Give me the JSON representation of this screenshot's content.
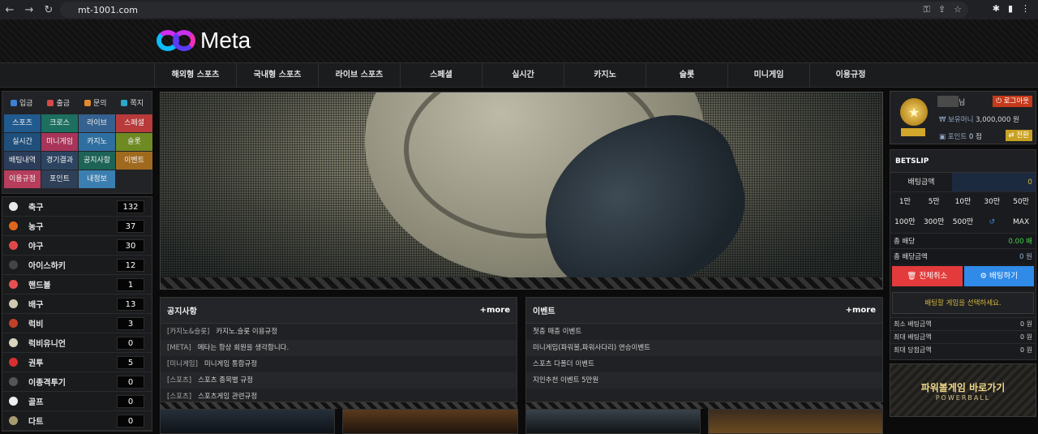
{
  "browser": {
    "url": "mt-1001.com"
  },
  "brand": {
    "name": "Meta"
  },
  "menu": [
    "해외형 스포츠",
    "국내형 스포츠",
    "라이브 스포츠",
    "스페셜",
    "실시간",
    "카지노",
    "슬롯",
    "미니게임",
    "이용규정"
  ],
  "quick_links": [
    {
      "label": "입금",
      "color": "#3d7fd4"
    },
    {
      "label": "출금",
      "color": "#d44a4a"
    },
    {
      "label": "문의",
      "color": "#e08a2a"
    },
    {
      "label": "쪽지",
      "color": "#2aa7c9"
    }
  ],
  "quick_grid": [
    {
      "label": "스포츠",
      "bg": "#215a8e"
    },
    {
      "label": "크로스",
      "bg": "#1d6f5f"
    },
    {
      "label": "라이브",
      "bg": "#34618f"
    },
    {
      "label": "스페셜",
      "bg": "#b83a3a"
    },
    {
      "label": "실시간",
      "bg": "#1f4f7a"
    },
    {
      "label": "미니게임",
      "bg": "#a8345a"
    },
    {
      "label": "카지노",
      "bg": "#2f6fa0"
    },
    {
      "label": "슬롯",
      "bg": "#6e8a22"
    },
    {
      "label": "배팅내역",
      "bg": "#2b3d5a"
    },
    {
      "label": "경기결과",
      "bg": "#2c4460"
    },
    {
      "label": "공지사항",
      "bg": "#1d6356"
    },
    {
      "label": "이벤트",
      "bg": "#a06a1e"
    },
    {
      "label": "이용규정",
      "bg": "#b63d5c"
    },
    {
      "label": "포인트",
      "bg": "#2f3f58"
    },
    {
      "label": "내정보",
      "bg": "#3b7fb0"
    }
  ],
  "sports": [
    {
      "name": "축구",
      "count": "132",
      "color": "#e8e8e8"
    },
    {
      "name": "농구",
      "count": "37",
      "color": "#e0661c"
    },
    {
      "name": "야구",
      "count": "30",
      "color": "#e04848"
    },
    {
      "name": "아이스하키",
      "count": "12",
      "color": "#444444"
    },
    {
      "name": "핸드볼",
      "count": "1",
      "color": "#e85050"
    },
    {
      "name": "배구",
      "count": "13",
      "color": "#d0c8b0"
    },
    {
      "name": "럭비",
      "count": "3",
      "color": "#c0402a"
    },
    {
      "name": "럭비유니언",
      "count": "0",
      "color": "#d8d4c0"
    },
    {
      "name": "권투",
      "count": "5",
      "color": "#d83030"
    },
    {
      "name": "이종격투기",
      "count": "0",
      "color": "#555555"
    },
    {
      "name": "골프",
      "count": "0",
      "color": "#f0f0f0"
    },
    {
      "name": "다트",
      "count": "0",
      "color": "#a89a70"
    }
  ],
  "notice": {
    "title": "공지사항",
    "more": "+more",
    "rows": [
      {
        "cat": "[카지노&슬롯]",
        "text": "카지노.슬롯 이용규정"
      },
      {
        "cat": "[META]",
        "text": "메타는 항상 회원을 생각합니다."
      },
      {
        "cat": "[미니게임]",
        "text": "미니게임 통합규정"
      },
      {
        "cat": "[스포츠]",
        "text": "스포츠 종목별 규정"
      },
      {
        "cat": "[스포츠]",
        "text": "스포츠게임 관련규정"
      }
    ]
  },
  "event": {
    "title": "이벤트",
    "more": "+more",
    "rows": [
      "첫충 매충 이벤트",
      "미니게임(파워볼,파워사다리) 연승이벤트",
      "스포츠 다폴더 이벤트",
      "지인추천 이벤트 5만원"
    ]
  },
  "user": {
    "suffix": "님",
    "logout": "로그아웃",
    "money_label": "₩ 보유머니",
    "money_value": "3,000,000 원",
    "point_label": "포인트",
    "point_value": "0 점",
    "convert": "전환"
  },
  "betslip": {
    "title": "BETSLIP",
    "amount_label": "배팅금액",
    "amount_value": "0",
    "chips": [
      "1만",
      "5만",
      "10만",
      "30만",
      "50만",
      "100만",
      "300만",
      "500만",
      "↺",
      "MAX"
    ],
    "total_odds_label": "총 배당",
    "total_odds_value": "0.00 배",
    "total_amount_label": "총 배당금액",
    "total_amount_value": "0 원",
    "cancel_all": "전체취소",
    "place_bet": "배팅하기",
    "notice": "배팅할 게임을 선택하세요.",
    "limits": [
      {
        "label": "최소 배팅금액",
        "value": "0 원"
      },
      {
        "label": "최대 배팅금액",
        "value": "0 원"
      },
      {
        "label": "최대 당첨금액",
        "value": "0 원"
      }
    ]
  },
  "powerball": {
    "title": "파워볼게임 바로가기",
    "sub": "POWERBALL"
  }
}
